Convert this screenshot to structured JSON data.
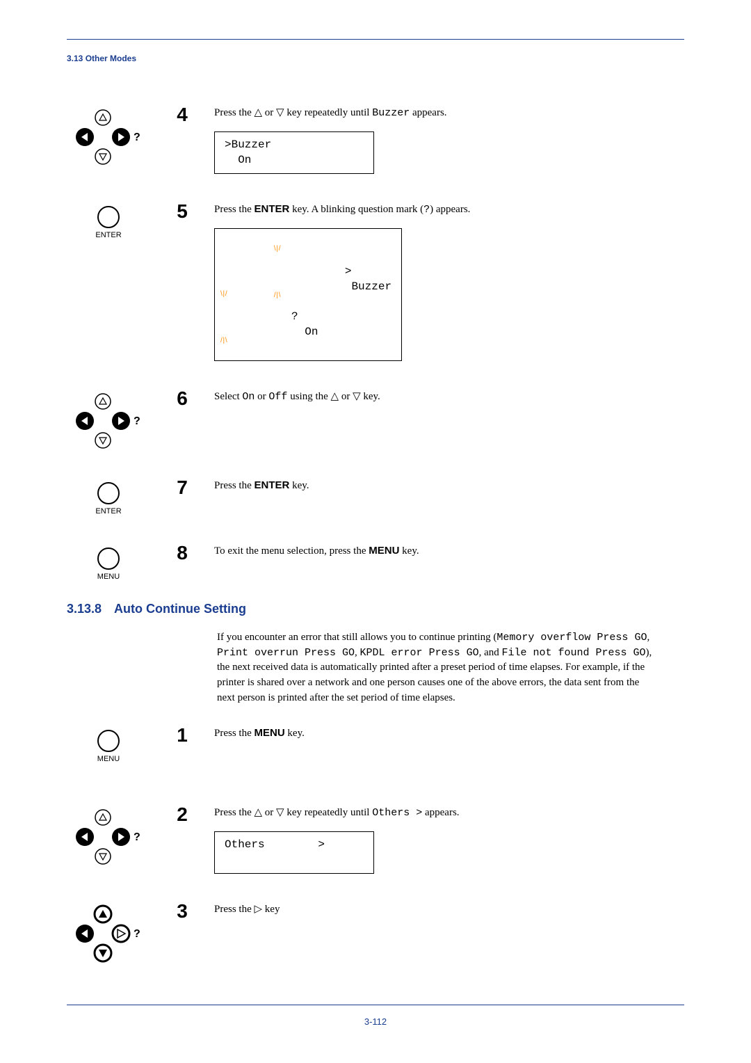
{
  "header": {
    "breadcrumb": "3.13 Other Modes"
  },
  "stepsA": [
    {
      "num": "4",
      "iconType": "dpad",
      "text_parts": [
        "Press the ",
        "△",
        " or ",
        "▽",
        " key repeatedly until ",
        "Buzzer",
        " appears."
      ],
      "lcd": ">Buzzer\n  On"
    },
    {
      "num": "5",
      "iconType": "enter",
      "text_parts": [
        "Press the ",
        "ENTER",
        " key. A blinking question mark (",
        "?",
        ") appears."
      ],
      "lcd_blink": {
        "line1": "Buzzer",
        "line2": " On"
      }
    },
    {
      "num": "6",
      "iconType": "dpad",
      "text_parts": [
        "Select ",
        "On",
        " or ",
        "Off",
        " using the ",
        "△",
        " or ",
        "▽",
        " key."
      ]
    },
    {
      "num": "7",
      "iconType": "enter",
      "text_parts": [
        "Press the ",
        "ENTER",
        " key."
      ]
    },
    {
      "num": "8",
      "iconType": "menu",
      "text_parts": [
        "To exit the menu selection, press the ",
        "MENU",
        " key."
      ]
    }
  ],
  "section": {
    "number": "3.13.8",
    "title": "Auto Continue Setting",
    "intro_parts": [
      "If you encounter an error that still allows you to continue printing (",
      "Memory overflow Press GO",
      ", ",
      "Print overrun Press GO",
      ", ",
      "KPDL error Press GO",
      ", and ",
      "File not found Press GO",
      "), the next received data is automatically printed after a preset period of time elapses. For example, if the printer is shared over a network and one person causes one of the above errors, the data sent from the next person is printed after the set period of time elapses."
    ]
  },
  "stepsB": [
    {
      "num": "1",
      "iconType": "menu",
      "text_parts": [
        "Press the ",
        "MENU",
        " key."
      ]
    },
    {
      "num": "2",
      "iconType": "dpad",
      "text_parts": [
        "Press the ",
        "△",
        " or ",
        "▽",
        " key repeatedly until ",
        "Others  >",
        " appears."
      ],
      "lcd": "Others        >\n "
    },
    {
      "num": "3",
      "iconType": "dpad-bold",
      "text_parts": [
        "Press the ",
        "▷",
        " key"
      ]
    }
  ],
  "footer": {
    "pagenum": "3-112"
  },
  "labels": {
    "enter": "ENTER",
    "menu": "MENU",
    "question": "?"
  }
}
